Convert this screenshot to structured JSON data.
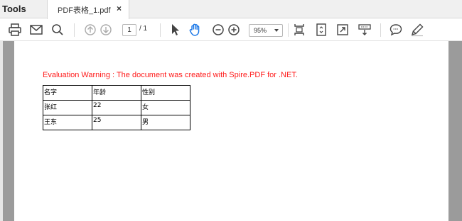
{
  "tabs": {
    "tools_label": "Tools",
    "document_label": "PDF表格_1.pdf",
    "close_glyph": "×"
  },
  "toolbar": {
    "icons": [
      "print-icon",
      "email-icon",
      "search-icon",
      "previous-page-icon",
      "next-page-icon",
      "select-cursor-icon",
      "hand-tool-icon",
      "zoom-out-icon",
      "zoom-in-icon",
      "fit-page-icon",
      "rotate-view-icon",
      "full-screen-icon",
      "scroll-mode-icon",
      "comment-icon",
      "highlight-pen-icon"
    ],
    "page_current": "1",
    "page_total": "/ 1",
    "zoom_value": "95%",
    "accent_color": "#1473e6"
  },
  "document": {
    "warning_text": "Evaluation Warning : The document was created with Spire.PDF for .NET.",
    "warning_color": "#ff1a1a",
    "table": [
      [
        "名字",
        "年龄",
        "性别"
      ],
      [
        "张红",
        "22",
        "女"
      ],
      [
        "王东",
        "25",
        "男"
      ]
    ]
  }
}
